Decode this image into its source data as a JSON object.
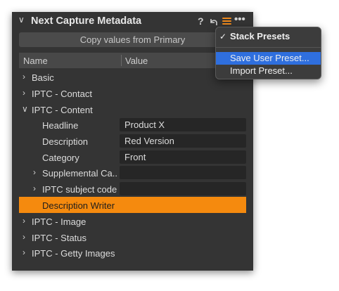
{
  "panel": {
    "title": "Next Capture Metadata",
    "help_label": "?",
    "more_label": "•••",
    "copy_button": "Copy values from Primary",
    "columns": {
      "name": "Name",
      "value": "Value"
    }
  },
  "tree": {
    "basic": "Basic",
    "iptc_contact": "IPTC - Contact",
    "iptc_content": "IPTC - Content",
    "headline": {
      "label": "Headline",
      "value": "Product X"
    },
    "description": {
      "label": "Description",
      "value": "Red Version"
    },
    "category": {
      "label": "Category",
      "value": "Front"
    },
    "supplemental": {
      "label": "Supplemental Ca...",
      "value": ""
    },
    "subject_code": {
      "label": "IPTC subject code",
      "value": ""
    },
    "description_writer": {
      "label": "Description Writer"
    },
    "iptc_image": "IPTC - Image",
    "iptc_status": "IPTC - Status",
    "iptc_getty": "IPTC - Getty Images"
  },
  "menu": {
    "stack_presets": "Stack Presets",
    "stack_presets_checked": "✓",
    "save_user_preset": "Save User Preset...",
    "import_preset": "Import Preset..."
  },
  "icons": {
    "collapse": "chevron-down-icon",
    "reset": "reset-arrow-icon",
    "presets": "presets-list-icon",
    "more": "more-dots-icon"
  },
  "colors": {
    "accent": "#f58a0e",
    "panel_bg": "#343434",
    "menu_highlight": "#2f6fde"
  }
}
